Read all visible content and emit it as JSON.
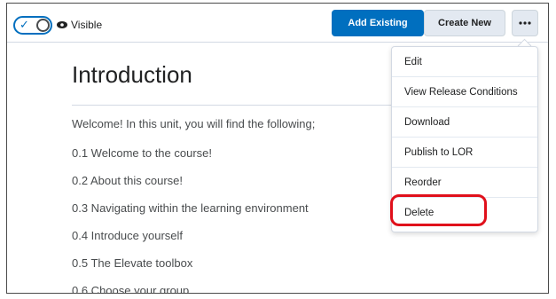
{
  "toolbar": {
    "visibility_label": "Visible",
    "add_existing_label": "Add Existing",
    "create_new_label": "Create New",
    "more_label": "•••"
  },
  "content": {
    "title": "Introduction",
    "paragraphs": [
      "Welcome! In this unit, you will find the following;",
      "0.1 Welcome to the course!",
      "0.2 About this course!",
      "0.3 Navigating within the learning environment",
      "0.4 Introduce yourself",
      "0.5 The Elevate toolbox",
      "0.6 Choose your group"
    ]
  },
  "menu": {
    "items": [
      "Edit",
      "View Release Conditions",
      "Download",
      "Publish to LOR",
      "Reorder",
      "Delete"
    ]
  },
  "colors": {
    "primary": "#006fbf",
    "highlight": "#e0101b"
  }
}
